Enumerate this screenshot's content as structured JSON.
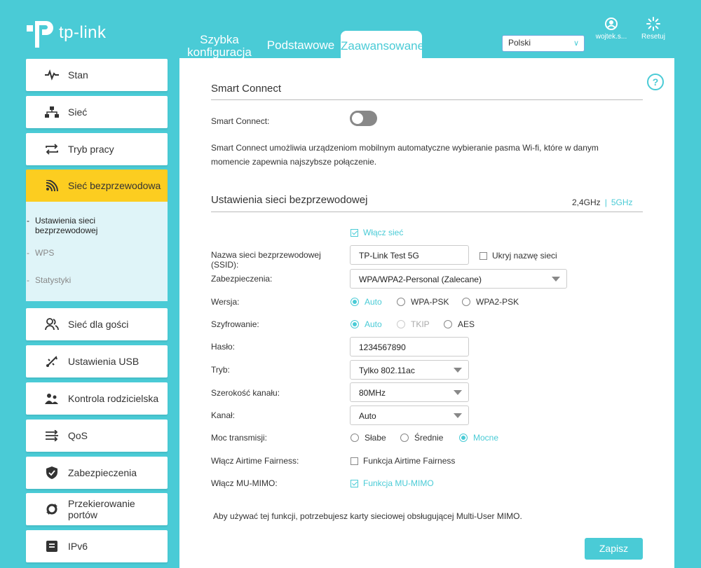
{
  "brand": {
    "name": "tp-link"
  },
  "nav": {
    "tabs": [
      {
        "label_line1": "Szybka",
        "label_line2": "konfiguracja"
      },
      {
        "label": "Podstawowe"
      },
      {
        "label": "Zaawansowane"
      }
    ]
  },
  "language": {
    "selected": "Polski"
  },
  "top_icons": {
    "user": "wojtek.s...",
    "reset": "Resetuj"
  },
  "sidebar": {
    "items": [
      {
        "label": "Stan",
        "icon": "pulse-icon"
      },
      {
        "label": "Sieć",
        "icon": "network-icon"
      },
      {
        "label": "Tryb pracy",
        "icon": "swap-icon"
      },
      {
        "label": "Sieć bezprzewodowa",
        "icon": "wifi-icon"
      },
      {
        "label": "Sieć dla gości",
        "icon": "guests-icon"
      },
      {
        "label": "Ustawienia USB",
        "icon": "usb-icon"
      },
      {
        "label": "Kontrola rodzicielska",
        "icon": "family-icon"
      },
      {
        "label": "QoS",
        "icon": "qos-icon"
      },
      {
        "label": "Zabezpieczenia",
        "icon": "shield-icon"
      },
      {
        "label_line1": "Przekierowanie",
        "label_line2": "portów",
        "icon": "forward-icon"
      },
      {
        "label": "IPv6",
        "icon": "ipv6-icon"
      }
    ],
    "subitems": [
      {
        "label_line1": "Ustawienia sieci",
        "label_line2": "bezprzewodowej"
      },
      {
        "label": "WPS"
      },
      {
        "label": "Statystyki"
      }
    ]
  },
  "smart_connect": {
    "title": "Smart Connect",
    "label": "Smart Connect:",
    "enabled": false,
    "desc_line1": "Smart Connect umożliwia urządzeniom mobilnym automatyczne wybieranie pasma Wi-fi, które w danym",
    "desc_line2": "momencie zapewnia najszybsze połączenie."
  },
  "wireless": {
    "title": "Ustawienia sieci bezprzewodowej",
    "band_24": "2,4GHz",
    "band_sep": "|",
    "band_5": "5GHz",
    "enable_label": "Włącz sieć",
    "ssid_label_line1": "Nazwa sieci bezprzewodowej",
    "ssid_label_line2": "(SSID):",
    "ssid_value": "TP-Link Test 5G",
    "hide_ssid_label": "Ukryj nazwę sieci",
    "security_label": "Zabezpieczenia:",
    "security_value": "WPA/WPA2-Personal (Zalecane)",
    "version_label": "Wersja:",
    "version_options": [
      "Auto",
      "WPA-PSK",
      "WPA2-PSK"
    ],
    "encryption_label": "Szyfrowanie:",
    "encryption_options": [
      "Auto",
      "TKIP",
      "AES"
    ],
    "password_label": "Hasło:",
    "password_value": "1234567890",
    "mode_label": "Tryb:",
    "mode_value": "Tylko 802.11ac",
    "width_label": "Szerokość kanału:",
    "width_value": "80MHz",
    "channel_label": "Kanał:",
    "channel_value": "Auto",
    "power_label": "Moc transmisji:",
    "power_options": [
      "Słabe",
      "Średnie",
      "Mocne"
    ],
    "airtime_label": "Włącz Airtime Fairness:",
    "airtime_option": "Funkcja Airtime Fairness",
    "mumimo_label": "Włącz MU-MIMO:",
    "mumimo_option": "Funkcja MU-MIMO",
    "mumimo_note": "Aby używać tej funkcji, potrzebujesz karty sieciowej obsługującej Multi-User MIMO.",
    "save_label": "Zapisz"
  },
  "colors": {
    "accent": "#4acbd6",
    "active_menu": "#fccd20"
  }
}
